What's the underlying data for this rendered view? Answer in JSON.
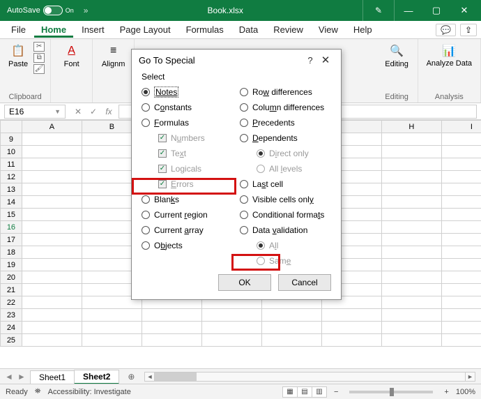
{
  "titlebar": {
    "autosave": "AutoSave",
    "autosave_state": "On",
    "qat_more": "»",
    "filename": "Book.xlsx",
    "pen_icon": "✎",
    "minimize": "—",
    "maximize": "▢",
    "close": "✕"
  },
  "tabs": {
    "file": "File",
    "home": "Home",
    "insert": "Insert",
    "pagelayout": "Page Layout",
    "formulas": "Formulas",
    "data": "Data",
    "review": "Review",
    "view": "View",
    "help": "Help",
    "comments_icon": "💬",
    "share_icon": "⇪"
  },
  "ribbon": {
    "clipboard": {
      "paste": "Paste",
      "label": "Clipboard",
      "paste_icon": "📋",
      "cut_icon": "✂",
      "copy_icon": "⧉",
      "format_icon": "🖌"
    },
    "font": {
      "label": "Font",
      "btn": "Font",
      "icon": "A"
    },
    "alignment": {
      "label": "Alignm",
      "btn": "Alignm"
    },
    "editing": {
      "label": "Editing",
      "btn": "Editing",
      "icon": "🔍"
    },
    "analysis": {
      "label": "Analysis",
      "btn": "Analyze Data",
      "icon": "📊"
    }
  },
  "namebox": {
    "value": "E16"
  },
  "fx": {
    "cancel": "✕",
    "enter": "✓",
    "fx": "fx"
  },
  "columns": [
    "A",
    "B",
    "",
    "",
    "",
    "",
    "H",
    "I"
  ],
  "rows": [
    "9",
    "10",
    "11",
    "12",
    "13",
    "14",
    "15",
    "16",
    "17",
    "18",
    "19",
    "20",
    "21",
    "22",
    "23",
    "24",
    "25"
  ],
  "selected_row": "16",
  "sheets": {
    "s1": "Sheet1",
    "s2": "Sheet2",
    "add": "⊕",
    "navl": "◄",
    "navr": "►"
  },
  "status": {
    "ready": "Ready",
    "acc": "Accessibility: Investigate",
    "zoom": "100%",
    "minus": "−",
    "plus": "+",
    "acc_icon": "⛯"
  },
  "dialog": {
    "title": "Go To Special",
    "help": "?",
    "close": "✕",
    "select": "Select",
    "left": {
      "notes": "Notes",
      "constants": "Constants",
      "formulas": "Formulas",
      "numbers": "Numbers",
      "text": "Text",
      "logicals": "Logicals",
      "errors": "Errors",
      "blanks": "Blanks",
      "currentregion": "Current region",
      "currentarray": "Current array",
      "objects": "Objects"
    },
    "right": {
      "rowdiff": "Row differences",
      "coldiff": "Column differences",
      "precedents": "Precedents",
      "dependents": "Dependents",
      "directonly": "Direct only",
      "alllevels": "All levels",
      "lastcell": "Last cell",
      "visible": "Visible cells only",
      "condfmt": "Conditional formats",
      "datavalid": "Data validation",
      "all": "All",
      "same": "Same"
    },
    "ok": "OK",
    "cancel": "Cancel"
  }
}
